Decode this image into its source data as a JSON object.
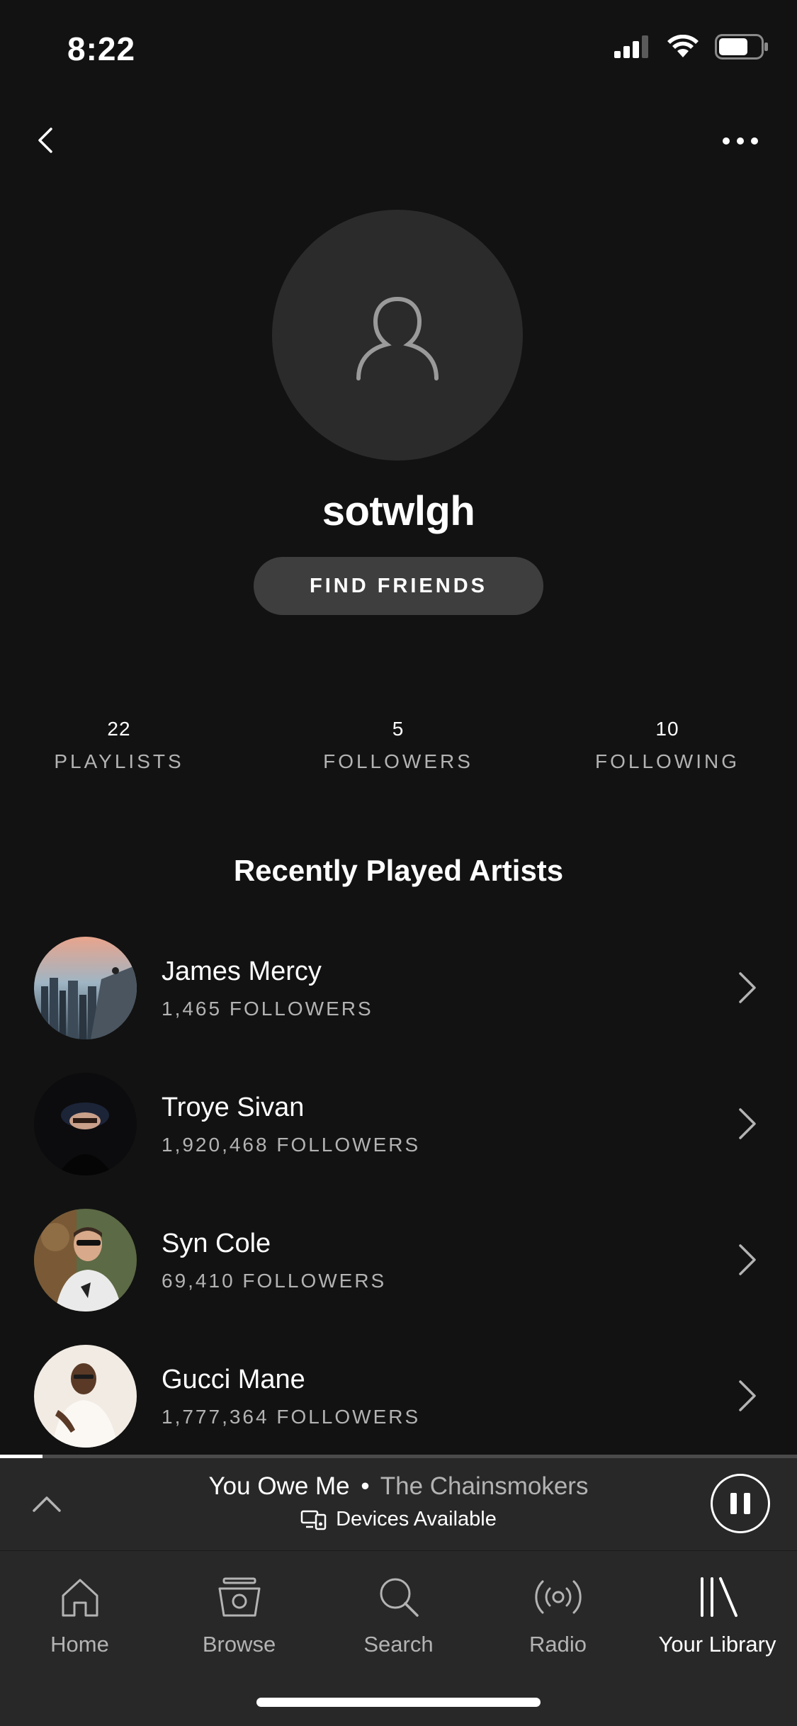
{
  "status_bar": {
    "time": "8:22",
    "icons": [
      "signal-icon",
      "wifi-icon",
      "battery-icon"
    ]
  },
  "nav": {
    "back_icon": "chevron-left-icon",
    "more_icon": "more-horizontal-icon"
  },
  "profile": {
    "avatar_icon": "user-icon",
    "username": "sotwlgh",
    "find_friends_label": "FIND FRIENDS"
  },
  "stats": [
    {
      "value": "22",
      "label": "PLAYLISTS"
    },
    {
      "value": "5",
      "label": "FOLLOWERS"
    },
    {
      "value": "10",
      "label": "FOLLOWING"
    }
  ],
  "recently_played": {
    "title": "Recently Played Artists",
    "artists": [
      {
        "name": "James Mercy",
        "followers": "1,465 FOLLOWERS"
      },
      {
        "name": "Troye Sivan",
        "followers": "1,920,468 FOLLOWERS"
      },
      {
        "name": "Syn Cole",
        "followers": "69,410 FOLLOWERS"
      },
      {
        "name": "Gucci Mane",
        "followers": "1,777,364 FOLLOWERS"
      }
    ]
  },
  "now_playing": {
    "track": "You Owe Me",
    "separator": "•",
    "artist": "The Chainsmokers",
    "devices_label": "Devices Available",
    "progress_fraction": 0.053,
    "icons": [
      "chevron-up-icon",
      "devices-icon",
      "pause-icon"
    ]
  },
  "tabs": [
    {
      "label": "Home",
      "icon": "home-icon",
      "active": false
    },
    {
      "label": "Browse",
      "icon": "browse-icon",
      "active": false
    },
    {
      "label": "Search",
      "icon": "search-icon",
      "active": false
    },
    {
      "label": "Radio",
      "icon": "radio-icon",
      "active": false
    },
    {
      "label": "Your Library",
      "icon": "library-icon",
      "active": true
    }
  ],
  "colors": {
    "background": "#121212",
    "surface": "#282828",
    "button": "#3e3e3e",
    "secondary_text": "#b3b3b3"
  }
}
